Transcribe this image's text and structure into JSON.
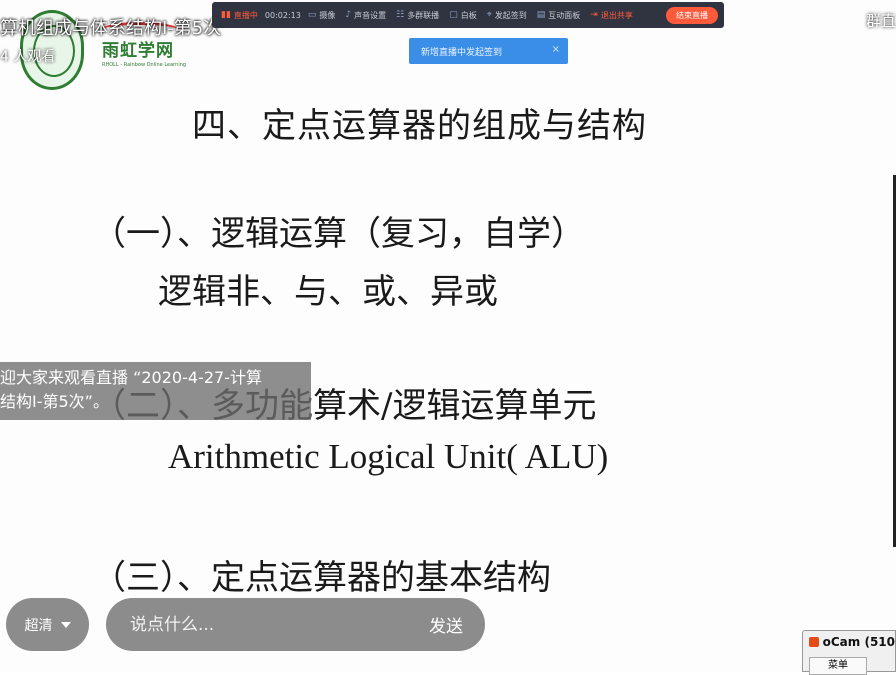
{
  "stream": {
    "title": "算机组成与体系结构I-第5次",
    "viewers": "4 人观看",
    "right_label": "群直"
  },
  "brand": {
    "name": "雨虹学网",
    "tagline": "RHOLL - Rainbow Online Learning"
  },
  "toolbar": {
    "live_label": "直播中",
    "timer": "00:02:13",
    "items": [
      "摄像",
      "声音设置",
      "多群联播",
      "白板",
      "发起签到",
      "互动面板"
    ],
    "exit_label": "退出共享",
    "end_label": "结束直播"
  },
  "notice": {
    "text": "新增直播中发起签到",
    "close": "×"
  },
  "slide": {
    "line1": "四、定点运算器的组成与结构",
    "line2": "（一）、逻辑运算（复习，自学）",
    "line3": "逻辑非、与、或、异或",
    "line4": "（二）、多功能算术/逻辑运算单元",
    "line5": "Arithmetic Logical Unit( ALU)",
    "line6": "（三）、定点运算器的基本结构"
  },
  "welcome": {
    "line1": "迎大家来观看直播 “2020-4-27-计算",
    "line2": "结构I-第5次”。"
  },
  "controls": {
    "quality_label": "超清",
    "chat_placeholder": "说点什么...",
    "send_label": "发送"
  },
  "ocam": {
    "title": "oCam (510",
    "menu": "菜单"
  },
  "colors": {
    "toolbar_bg": "#2f3440",
    "accent_red": "#ff5a3c",
    "notice_blue": "#3b8ee8",
    "brand_green": "#2e7d32"
  }
}
